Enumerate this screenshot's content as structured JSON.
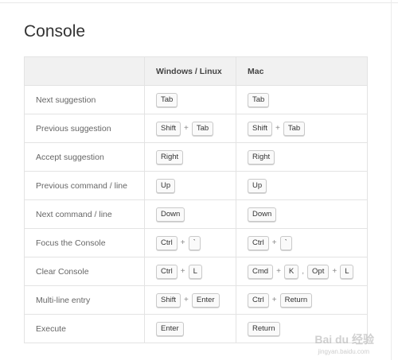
{
  "title": "Console",
  "headers": [
    "",
    "Windows / Linux",
    "Mac"
  ],
  "rows": [
    {
      "action": "Next suggestion",
      "win": [
        [
          "Tab"
        ]
      ],
      "mac": [
        [
          "Tab"
        ]
      ]
    },
    {
      "action": "Previous suggestion",
      "win": [
        [
          "Shift",
          "Tab"
        ]
      ],
      "mac": [
        [
          "Shift",
          "Tab"
        ]
      ]
    },
    {
      "action": "Accept suggestion",
      "win": [
        [
          "Right"
        ]
      ],
      "mac": [
        [
          "Right"
        ]
      ]
    },
    {
      "action": "Previous command / line",
      "win": [
        [
          "Up"
        ]
      ],
      "mac": [
        [
          "Up"
        ]
      ]
    },
    {
      "action": "Next command / line",
      "win": [
        [
          "Down"
        ]
      ],
      "mac": [
        [
          "Down"
        ]
      ]
    },
    {
      "action": "Focus the Console",
      "win": [
        [
          "Ctrl",
          "`"
        ]
      ],
      "mac": [
        [
          "Ctrl",
          "`"
        ]
      ]
    },
    {
      "action": "Clear Console",
      "win": [
        [
          "Ctrl",
          "L"
        ]
      ],
      "mac": [
        [
          "Cmd",
          "K"
        ],
        [
          "Opt",
          "L"
        ]
      ]
    },
    {
      "action": "Multi-line entry",
      "win": [
        [
          "Shift",
          "Enter"
        ]
      ],
      "mac": [
        [
          "Ctrl",
          "Return"
        ]
      ]
    },
    {
      "action": "Execute",
      "win": [
        [
          "Enter"
        ]
      ],
      "mac": [
        [
          "Return"
        ]
      ]
    }
  ],
  "separators": {
    "plus": "+",
    "comma": ","
  },
  "watermark": {
    "text": "Bai du 经验",
    "url": "jingyan.baidu.com"
  }
}
